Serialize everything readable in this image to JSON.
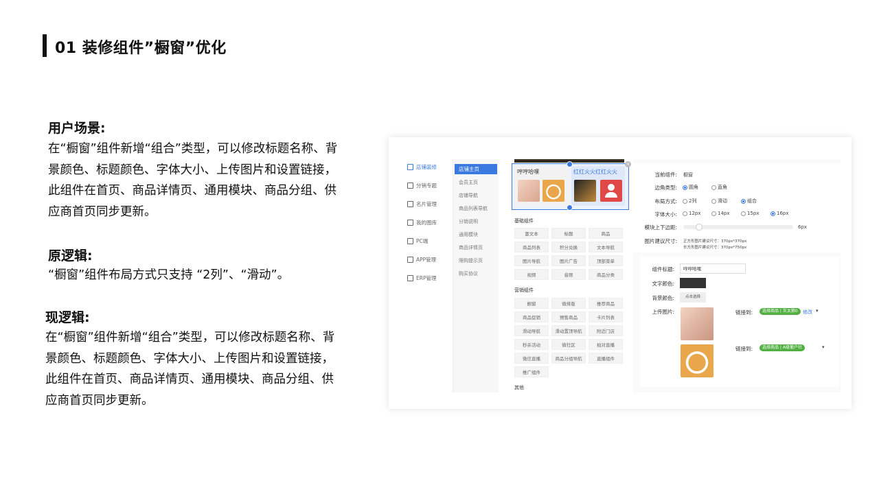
{
  "title": "01 装修组件”橱窗”优化",
  "sections": {
    "scenario_heading": "用户场景:",
    "scenario_text": "在“橱窗”组件新增“组合”类型，可以修改标题名称、背景颜色、标题颜色、字体大小、上传图片和设置链接，此组件在首页、商品详情页、通用模块、商品分组、供应商首页同步更新。",
    "old_heading": "原逻辑:",
    "old_text": "“橱窗”组件布局方式只支持 “2列”、“滑动”。",
    "new_heading": "现逻辑:",
    "new_text": "在“橱窗”组件新增“组合”类型，可以修改标题名称、背景颜色、标题颜色、字体大小、上传图片和设置链接，此组件在首页、商品详情页、通用模块、商品分组、供应商首页同步更新。"
  },
  "screenshot": {
    "nav_primary": [
      "店铺装修",
      "分销专题",
      "名片管理",
      "我的图库",
      "PC端",
      "APP管理",
      "ERP管理"
    ],
    "nav_secondary_active": "店铺主页",
    "nav_secondary": [
      "会员主页",
      "店铺导航",
      "商品列表导航",
      "分销说明",
      "通用模块",
      "商品详情页",
      "限购提示页",
      "购买协议"
    ],
    "preview": {
      "card1_title": "哼哼哈嘿",
      "card2_title": "红红火火红红火火",
      "close_icon": "×"
    },
    "groups": [
      {
        "title": "基础组件",
        "items": [
          "富文本",
          "标题",
          "商品",
          "商品列表",
          "积分兑换",
          "文本导航",
          "图片导航",
          "图片广告",
          "顶部菜单",
          "视频",
          "音频",
          "商品分类"
        ]
      },
      {
        "title": "营销组件",
        "items": [
          "橱窗",
          "微排版",
          "推荐商品",
          "商品促销",
          "预售商品",
          "卡片列表",
          "滑动导航",
          "滑动置顶导航",
          "附近门店",
          "秒杀活动",
          "微社区",
          "拍对直播",
          "微信直播",
          "商品分组导航",
          "直播组件",
          "推广组件"
        ]
      },
      {
        "title": "其他",
        "items": []
      }
    ],
    "settings": {
      "current_label": "当前组件:",
      "current_value": "橱窗",
      "corner_label": "边角类型:",
      "corner_options": [
        "圆角",
        "直角"
      ],
      "corner_selected": "圆角",
      "layout_label": "布局方式:",
      "layout_options": [
        "2列",
        "滑动",
        "组合"
      ],
      "layout_selected": "组合",
      "font_label": "字体大小:",
      "font_options": [
        "12px",
        "14px",
        "15px",
        "16px"
      ],
      "font_selected": "16px",
      "margin_label": "模块上下边距:",
      "margin_value": "6px",
      "margin_slider_level": 0.06,
      "img_label": "图片建议尺寸:",
      "img_hint1": "正方形图片建议尺寸：370px*370px",
      "img_hint2": "长方形图片建议尺寸：370px*750px"
    },
    "component": {
      "title_label": "组件标题:",
      "title_value": "哼哼哈嘿",
      "text_color_label": "文字颜色:",
      "text_color": "#333333",
      "bg_color_label": "背景颜色:",
      "bg_color_button": "点击选择",
      "upload_label": "上传图片:",
      "link_label": "链接到:",
      "link1": "选择商品 | 灰太狼0",
      "link2": "选择商品 | A级葡户社",
      "edit_label": "修改",
      "accent": "#3a7ae0",
      "pill_color": "#52b043"
    }
  }
}
